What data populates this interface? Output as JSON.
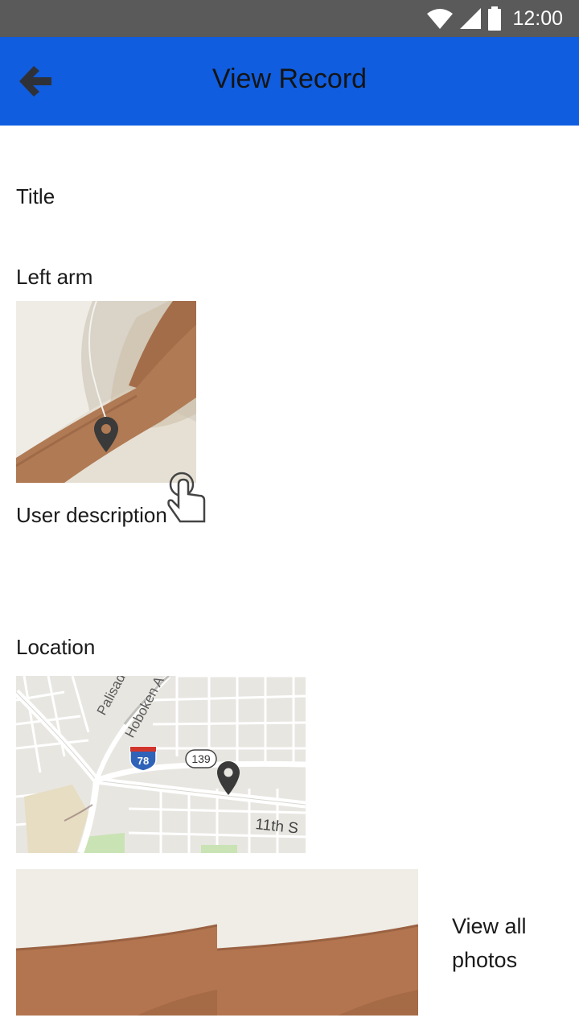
{
  "status_bar": {
    "time": "12:00"
  },
  "app_bar": {
    "title": "View Record"
  },
  "record": {
    "title_label": "Title",
    "body_part_label": "Left arm",
    "description_label": "User description",
    "location_label": "Location"
  },
  "map": {
    "street_palisade": "Palisade",
    "street_hoboken": "Hoboken A",
    "interstate_shield": "78",
    "route_shield": "139",
    "street_11th": "11th S"
  },
  "gallery": {
    "view_all_label": "View all photos"
  },
  "colors": {
    "status_bar": "#5a5a5a",
    "app_bar": "#105ddf",
    "background": "#ffffff"
  }
}
